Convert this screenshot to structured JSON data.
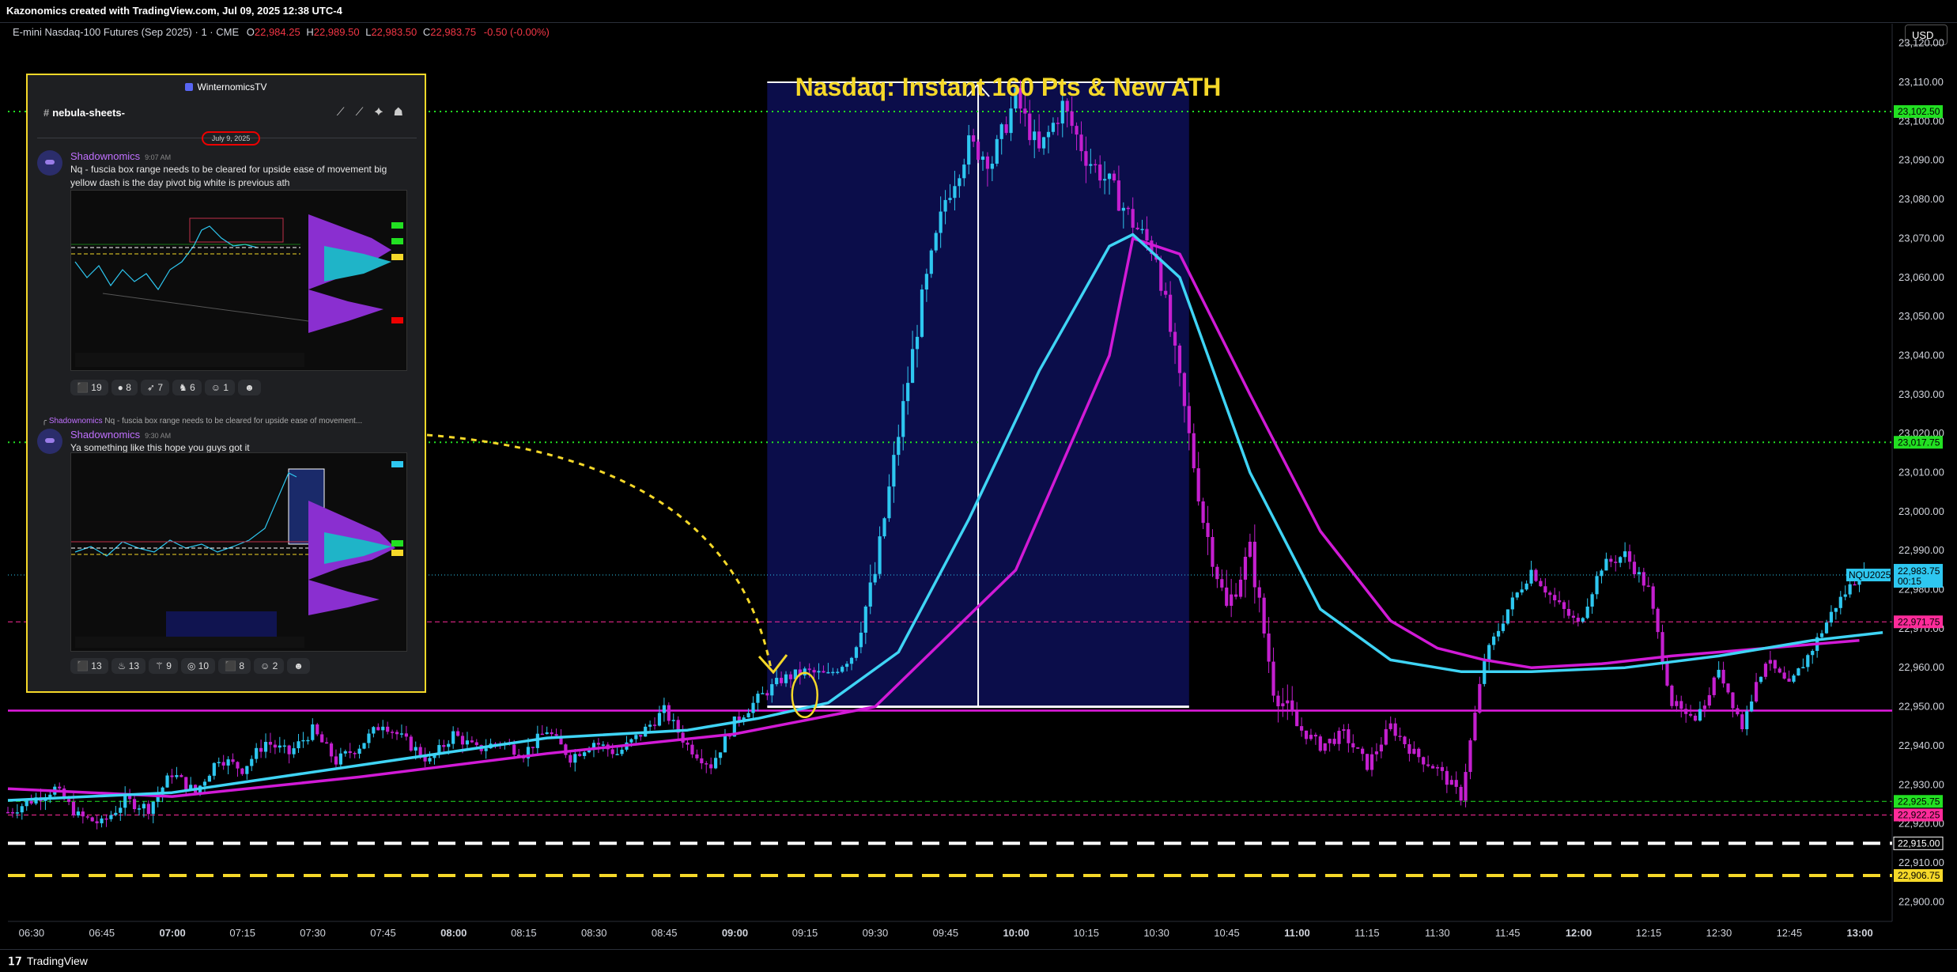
{
  "header": {
    "attribution": "Kazonomics created with TradingView.com, Jul 09, 2025 12:38 UTC-4",
    "symbol": "E-mini Nasdaq-100 Futures (Sep 2025) · 1 · CME",
    "o_label": "O",
    "o": "22,984.25",
    "h_label": "H",
    "h": "22,989.50",
    "l_label": "L",
    "l": "22,983.50",
    "c_label": "C",
    "c": "22,983.75",
    "change": "-0.50 (-0.00%)",
    "currency": "USD"
  },
  "annotation": {
    "title": "Nasdaq: Instant 160 Pts & New ATH"
  },
  "footer": {
    "brand": "TradingView"
  },
  "panel": {
    "server": "WinternomicsTV",
    "channel": "nebula-sheets-",
    "date_sep": "July 9, 2025",
    "messages": [
      {
        "user": "Shadownomics",
        "time": "9:07 AM",
        "text": "Nq - fuscia box range needs to be cleared for upside ease of movement big yellow dash is the day pivot big white is previous ath",
        "reactions": [
          "19",
          "8",
          "7",
          "6",
          "1"
        ]
      },
      {
        "reply_user": "Shadownomics",
        "reply_text": "Nq - fuscia box range needs to be cleared for upside ease of movement...",
        "user": "Shadownomics",
        "time": "9:30 AM",
        "text": "Ya something like this hope you guys got it",
        "reactions": [
          "13",
          "13",
          "9",
          "10",
          "8",
          "2"
        ]
      }
    ]
  },
  "colors": {
    "bull": "#2ec7f0",
    "bear": "#c41fcf",
    "ema_fast": "#3fd4f5",
    "ema_slow": "#d11ad6",
    "green_level": "#22e022",
    "pink_level": "#ff2b9a",
    "magenta_line": "#e21ae0",
    "yellow": "#f5d829",
    "box": "#0b0d4a"
  },
  "chart_data": {
    "type": "candlestick",
    "title": "Nasdaq: Instant 160 Pts & New ATH",
    "ylim": [
      22895,
      23125
    ],
    "y_ticks": [
      22900,
      22910,
      22920,
      22930,
      22940,
      22950,
      22960,
      22970,
      22980,
      22990,
      23000,
      23010,
      23020,
      23030,
      23040,
      23050,
      23060,
      23070,
      23080,
      23090,
      23100,
      23110,
      23120
    ],
    "x_ticks": [
      "06:30",
      "06:45",
      "07:00",
      "07:15",
      "07:30",
      "07:45",
      "08:00",
      "08:15",
      "08:30",
      "08:45",
      "09:00",
      "09:15",
      "09:30",
      "09:45",
      "10:00",
      "10:15",
      "10:30",
      "10:45",
      "11:00",
      "11:15",
      "11:30",
      "11:45",
      "12:00",
      "12:15",
      "12:30",
      "12:45",
      "13:00"
    ],
    "x_range_minutes": [
      385,
      787
    ],
    "levels": [
      {
        "price": 23102.5,
        "label": "23,102.50",
        "style": "dotted",
        "color": "#22e022"
      },
      {
        "price": 23017.75,
        "label": "23,017.75",
        "style": "dotted",
        "color": "#22e022"
      },
      {
        "price": 22971.75,
        "label": "22,971.75",
        "style": "dashed",
        "color": "#ff2b9a"
      },
      {
        "price": 22949.0,
        "label": "",
        "style": "solid",
        "color": "#e21ae0"
      },
      {
        "price": 22925.75,
        "label": "22,925.75",
        "style": "dashed",
        "color": "#22e022"
      },
      {
        "price": 22922.25,
        "label": "22,922.25",
        "style": "dashed",
        "color": "#ff2b9a"
      },
      {
        "price": 22915.0,
        "label": "22,915.00",
        "style": "bigdash",
        "color": "#ffffff"
      },
      {
        "price": 22906.75,
        "label": "22,906.75",
        "style": "bigdash",
        "color": "#f5d829"
      }
    ],
    "last_price": {
      "label": "NQU2025",
      "price": "22,983.75",
      "countdown": "00:15"
    },
    "range_box": {
      "from_minute": 547,
      "to_minute": 637,
      "low": 22950,
      "high": 23110
    },
    "range_arrow_minute": 592,
    "price_path": [
      [
        385,
        22923
      ],
      [
        390,
        22926
      ],
      [
        395,
        22929
      ],
      [
        400,
        22922
      ],
      [
        405,
        22920
      ],
      [
        410,
        22926
      ],
      [
        415,
        22924
      ],
      [
        420,
        22933
      ],
      [
        425,
        22928
      ],
      [
        430,
        22937
      ],
      [
        435,
        22934
      ],
      [
        440,
        22941
      ],
      [
        445,
        22938
      ],
      [
        450,
        22944
      ],
      [
        455,
        22936
      ],
      [
        460,
        22940
      ],
      [
        465,
        22946
      ],
      [
        470,
        22941
      ],
      [
        475,
        22936
      ],
      [
        480,
        22943
      ],
      [
        485,
        22939
      ],
      [
        490,
        22941
      ],
      [
        495,
        22938
      ],
      [
        500,
        22944
      ],
      [
        505,
        22937
      ],
      [
        510,
        22941
      ],
      [
        515,
        22938
      ],
      [
        520,
        22943
      ],
      [
        525,
        22949
      ],
      [
        530,
        22940
      ],
      [
        535,
        22935
      ],
      [
        540,
        22946
      ],
      [
        545,
        22952
      ],
      [
        550,
        22957
      ],
      [
        555,
        22959
      ],
      [
        560,
        22958
      ],
      [
        565,
        22963
      ],
      [
        570,
        22984
      ],
      [
        575,
        23020
      ],
      [
        580,
        23054
      ],
      [
        585,
        23080
      ],
      [
        590,
        23094
      ],
      [
        595,
        23090
      ],
      [
        600,
        23106
      ],
      [
        605,
        23092
      ],
      [
        610,
        23104
      ],
      [
        615,
        23091
      ],
      [
        620,
        23084
      ],
      [
        625,
        23074
      ],
      [
        630,
        23066
      ],
      [
        635,
        23033
      ],
      [
        640,
        22998
      ],
      [
        645,
        22975
      ],
      [
        650,
        22990
      ],
      [
        655,
        22955
      ],
      [
        660,
        22945
      ],
      [
        665,
        22940
      ],
      [
        670,
        22943
      ],
      [
        675,
        22935
      ],
      [
        680,
        22945
      ],
      [
        685,
        22938
      ],
      [
        690,
        22934
      ],
      [
        695,
        22927
      ],
      [
        700,
        22962
      ],
      [
        705,
        22975
      ],
      [
        710,
        22985
      ],
      [
        715,
        22977
      ],
      [
        720,
        22971
      ],
      [
        725,
        22986
      ],
      [
        730,
        22989
      ],
      [
        735,
        22980
      ],
      [
        740,
        22951
      ],
      [
        745,
        22946
      ],
      [
        750,
        22960
      ],
      [
        755,
        22945
      ],
      [
        760,
        22962
      ],
      [
        765,
        22955
      ],
      [
        770,
        22965
      ],
      [
        775,
        22976
      ],
      [
        780,
        22984
      ],
      [
        782,
        22984
      ]
    ],
    "ema_fast": [
      [
        385,
        22926
      ],
      [
        420,
        22928
      ],
      [
        460,
        22935
      ],
      [
        500,
        22942
      ],
      [
        530,
        22944
      ],
      [
        545,
        22947
      ],
      [
        560,
        22951
      ],
      [
        575,
        22964
      ],
      [
        590,
        22998
      ],
      [
        605,
        23036
      ],
      [
        620,
        23068
      ],
      [
        625,
        23071
      ],
      [
        635,
        23060
      ],
      [
        650,
        23010
      ],
      [
        665,
        22975
      ],
      [
        680,
        22962
      ],
      [
        695,
        22959
      ],
      [
        710,
        22959
      ],
      [
        730,
        22960
      ],
      [
        750,
        22963
      ],
      [
        770,
        22967
      ],
      [
        785,
        22969
      ]
    ],
    "ema_slow": [
      [
        385,
        22929
      ],
      [
        420,
        22927
      ],
      [
        460,
        22932
      ],
      [
        500,
        22938
      ],
      [
        540,
        22943
      ],
      [
        570,
        22950
      ],
      [
        600,
        22985
      ],
      [
        620,
        23040
      ],
      [
        625,
        23070
      ],
      [
        635,
        23066
      ],
      [
        650,
        23030
      ],
      [
        665,
        22995
      ],
      [
        680,
        22972
      ],
      [
        690,
        22965
      ],
      [
        700,
        22962
      ],
      [
        710,
        22960
      ],
      [
        725,
        22961
      ],
      [
        740,
        22963
      ],
      [
        760,
        22965
      ],
      [
        780,
        22967
      ]
    ]
  }
}
